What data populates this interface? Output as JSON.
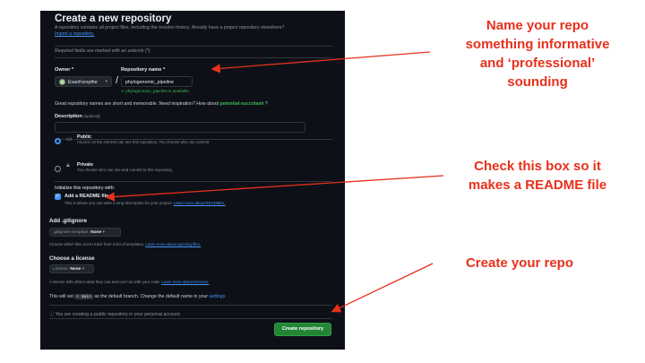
{
  "github": {
    "title": "Create a new repository",
    "description": "A repository contains all project files, including the revision history. Already have a project repository elsewhere?",
    "import_link": "Import a repository.",
    "required_note": "Required fields are marked with an asterisk (*).",
    "owner_label": "Owner *",
    "owner_value": "EvanForsythe",
    "repo_label": "Repository name *",
    "repo_value": "phylogenomic_pipeline",
    "availability": "phylogenomic_pipeline is available.",
    "inspiration_prefix": "Great repository names are short and memorable. Need inspiration? How about",
    "inspiration_suggestion": "potential-succotash",
    "inspiration_suffix": "?",
    "description_label": "Description",
    "description_optional": "(optional)",
    "visibility": [
      {
        "title": "Public",
        "subtitle": "Anyone on the internet can see this repository. You choose who can commit.",
        "selected": true,
        "icon": "repo-icon"
      },
      {
        "title": "Private",
        "subtitle": "You choose who can see and commit to this repository.",
        "selected": false,
        "icon": "lock-icon"
      }
    ],
    "initialize_heading": "Initialize this repository with:",
    "readme_label": "Add a README file",
    "readme_checked": true,
    "readme_help_prefix": "This is where you can write a long description for your project.",
    "readme_help_link": "Learn more about READMEs.",
    "gitignore_heading": "Add .gitignore",
    "gitignore_select_label": ".gitignore template:",
    "gitignore_select_value": "None",
    "gitignore_help_prefix": "Choose which files not to track from a list of templates.",
    "gitignore_help_link": "Learn more about ignoring files.",
    "license_heading": "Choose a license",
    "license_select_label": "License:",
    "license_select_value": "None",
    "license_help_prefix": "A license tells others what they can and can't do with your code.",
    "license_help_link": "Learn more about licenses.",
    "branch_prefix": "This will set",
    "branch_name": "main",
    "branch_suffix": "as the default branch. Change the default name in your",
    "branch_link": "settings",
    "public_notice": "You are creating a public repository in your personal account.",
    "create_button": "Create repository"
  },
  "annotations": {
    "name_note": [
      "Name your repo",
      "something informative",
      "and ‘professional’",
      "sounding"
    ],
    "readme_note": [
      "Check this box so it",
      "makes a README file"
    ],
    "create_note": [
      "Create your repo"
    ],
    "color": "#e8301c"
  }
}
